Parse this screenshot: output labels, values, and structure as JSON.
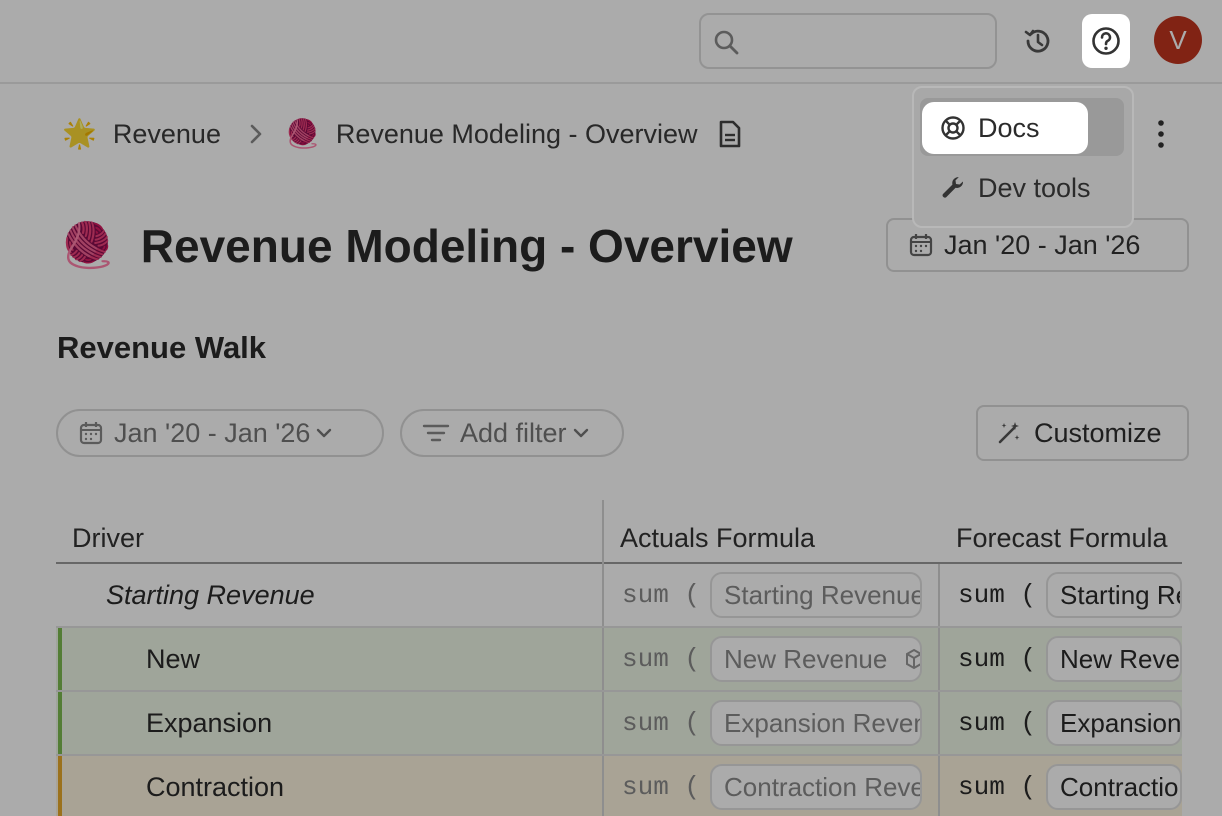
{
  "topbar": {
    "search_placeholder": "",
    "avatar_initial": "V"
  },
  "breadcrumb": {
    "items": [
      {
        "emoji": "🌟",
        "label": "Revenue"
      },
      {
        "emoji": "🧶",
        "label": "Revenue Modeling - Overview"
      }
    ]
  },
  "page": {
    "emoji": "🧶",
    "title": "Revenue Modeling - Overview",
    "date_range": "Jan '20 - Jan '26"
  },
  "section": {
    "title": "Revenue Walk",
    "date_filter": "Jan '20 - Jan '26",
    "add_filter": "Add filter",
    "customize": "Customize"
  },
  "table": {
    "columns": [
      "Driver",
      "Actuals Formula",
      "Forecast Formula"
    ],
    "function_label": "sum (",
    "rows": [
      {
        "driver": "Starting Revenue",
        "actuals_ref": "Starting Revenue",
        "forecast_ref": "Starting Revenue",
        "color": ""
      },
      {
        "driver": "New",
        "actuals_ref": "New Revenue",
        "forecast_ref": "New Revenue",
        "color": "#7cbb4f"
      },
      {
        "driver": "Expansion",
        "actuals_ref": "Expansion Revenue",
        "forecast_ref": "Expansion Revenue",
        "color": "#7cbb4f"
      },
      {
        "driver": "Contraction",
        "actuals_ref": "Contraction Revenue",
        "forecast_ref": "Contraction Revenue",
        "color": "#e8a92b"
      }
    ]
  },
  "help_menu": {
    "items": [
      {
        "label": "Docs",
        "icon": "lifebuoy-icon"
      },
      {
        "label": "Dev tools",
        "icon": "wrench-icon"
      }
    ]
  }
}
